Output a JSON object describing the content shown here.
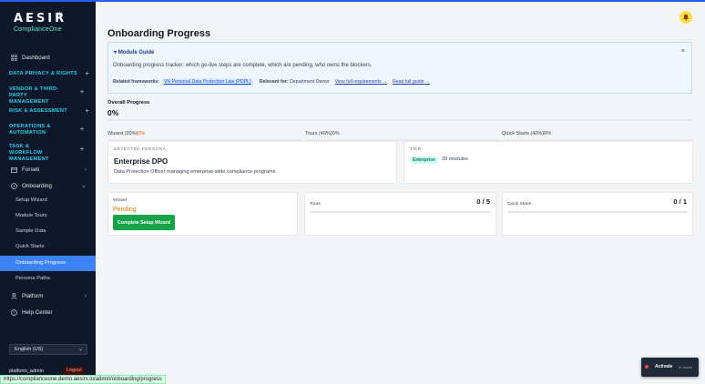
{
  "app": {
    "logo_text": "AESIR",
    "logo_sub": "ComplianceOne"
  },
  "sidebar": {
    "dashboard": "Dashboard",
    "sections": [
      {
        "label": "DATA PRIVACY & RIGHTS"
      },
      {
        "label": "VENDOR & THIRD-PARTY MANAGEMENT"
      },
      {
        "label": "RISK & ASSESSMENT"
      },
      {
        "label": "OPERATIONS & AUTOMATION"
      },
      {
        "label": "TASK & WORKFLOW MANAGEMENT"
      }
    ],
    "forseti": "Forseti",
    "onboarding": "Onboarding",
    "onboarding_items": [
      "Setup Wizard",
      "Module Tours",
      "Sample Data",
      "Quick Starts",
      "Onboarding Progress",
      "Persona Paths"
    ],
    "active_item": "Onboarding Progress",
    "platform": "Platform",
    "help_center": "Help Center",
    "language": "English (US)",
    "username": "platform_admin",
    "logout": "Logout"
  },
  "main": {
    "title": "Onboarding Progress",
    "guide": {
      "title": "Module Guide",
      "close": "×",
      "description": "Onboarding progress tracker: which go-live steps are complete, which are pending, who owns the blockers.",
      "related_label": "Related frameworks:",
      "related_chip": "VN Personal Data Protection Law (PDPL)",
      "relevant_label": "Relevant for:",
      "relevant_value": "Department Owner",
      "view_link": "View full requirements →",
      "read_link": "Read full guide →"
    },
    "overall": {
      "label": "Overall Progress",
      "value": "0%",
      "fraction": 0
    },
    "segments": [
      {
        "label": "Wizard (20%)",
        "pct": "0%",
        "fraction": 0
      },
      {
        "label": "Tours (40%)",
        "pct": "0%",
        "fraction": 0
      },
      {
        "label": "Quick Starts (40%)",
        "pct": "0%",
        "fraction": 0
      }
    ],
    "persona": {
      "caption": "DETECTED PERSONA",
      "title": "Enterprise DPO",
      "description": "Data Protection Officer managing enterprise-wide compliance programs"
    },
    "tier": {
      "caption": "TIER",
      "badge": "Enterprise",
      "modules": "28 modules"
    },
    "wizard": {
      "caption": "Wizard",
      "status": "Pending",
      "button": "Complete Setup Wizard"
    },
    "tours": {
      "caption": "Tours",
      "count": "0 / 5",
      "fraction": 0
    },
    "quick_starts": {
      "caption": "Quick Starts",
      "count": "0 / 1",
      "fraction": 0
    }
  },
  "status_bar": {
    "url": "https://complianceone.demo.aesirx.io/admin/onboarding/progress"
  },
  "toast": {
    "label": "Activate",
    "sub": "of Assist"
  },
  "colors": {
    "accent": "#3b82f6",
    "sidebar_bg": "#0f172a",
    "section_color": "#22d3ee",
    "pending": "#d97706",
    "success": "#16a34a"
  }
}
